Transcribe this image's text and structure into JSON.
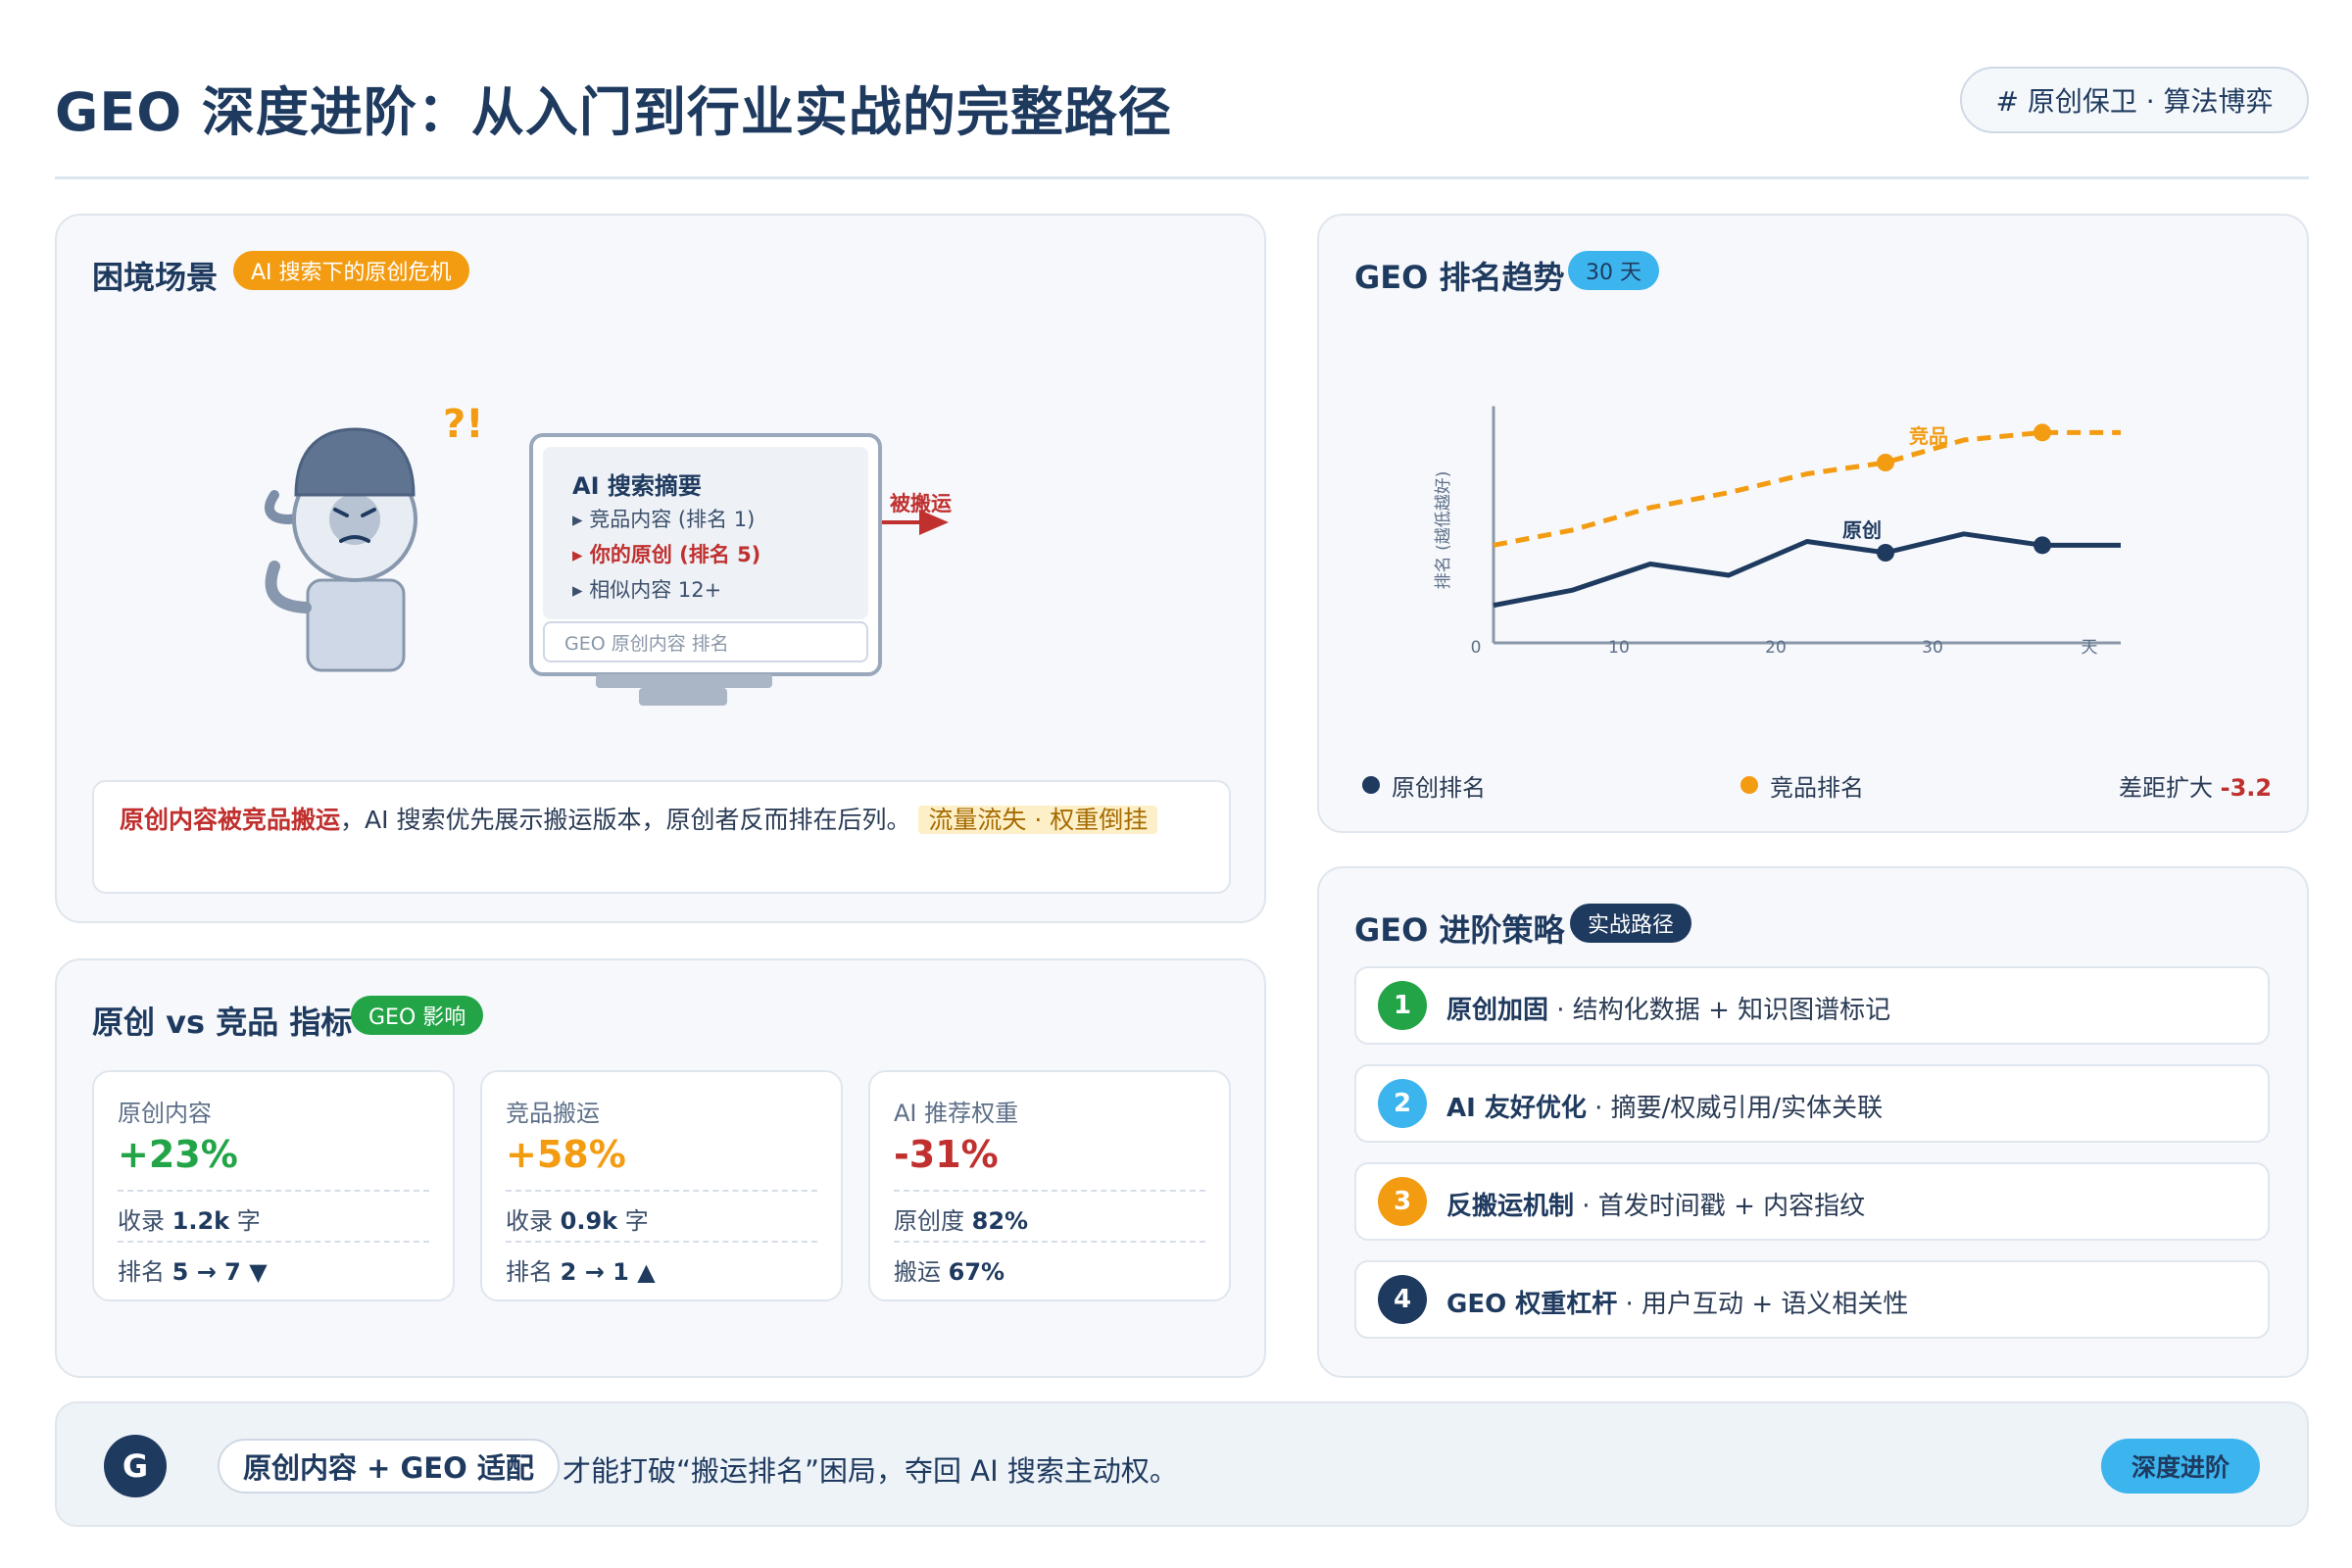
{
  "header": {
    "title": "GEO 深度进阶：从入门到行业实战的完整路径",
    "tag": "# 原创保卫 · 算法博弈"
  },
  "scenario": {
    "title": "困境场景",
    "badge": "AI 搜索下的原创危机",
    "confused_mark": "?!",
    "monitor": {
      "title": "AI 搜索摘要",
      "lines": [
        "▸ 竞品内容 (排名 1)",
        "▸ 你的原创 (排名 5)",
        "▸ 相似内容 12+"
      ],
      "search_placeholder": "GEO 原创内容 排名"
    },
    "arrow_label": "被搬运",
    "text_strong": "原创内容被竞品搬运",
    "text_body": "，AI 搜索优先展示搬运版本，原创者反而排在后列。",
    "text_highlight": "流量流失 · 权重倒挂"
  },
  "metrics": {
    "title": "原创 vs 竞品 指标",
    "badge": "GEO 影响",
    "cards": [
      {
        "label": "原创内容",
        "value": "+23%",
        "color": "#22a447",
        "row1_k": "收录 ",
        "row1_v": "1.2k",
        "row1_s": " 字",
        "row2_k": "排名 ",
        "row2_v": "5 → 7 ▼",
        "row2_s": ""
      },
      {
        "label": "竞品搬运",
        "value": "+58%",
        "color": "#f39c12",
        "row1_k": "收录 ",
        "row1_v": "0.9k",
        "row1_s": " 字",
        "row2_k": "排名 ",
        "row2_v": "2 → 1 ▲",
        "row2_s": ""
      },
      {
        "label": "AI 推荐权重",
        "value": "-31%",
        "color": "#c0302f",
        "row1_k": "原创度 ",
        "row1_v": "82%",
        "row1_s": "",
        "row2_k": "搬运 ",
        "row2_v": "67%",
        "row2_s": ""
      }
    ]
  },
  "trend": {
    "title": "GEO 排名趋势",
    "badge": "30 天",
    "legend": {
      "original": "原创排名",
      "competitor": "竞品排名",
      "gap_label": "差距扩大 ",
      "gap_value": "-3.2"
    }
  },
  "chart_data": {
    "type": "line",
    "ylabel": "排名 (越低越好)",
    "xlabel": "",
    "x_ticks": [
      "0",
      "10",
      "20",
      "30",
      "天"
    ],
    "series": [
      {
        "name": "原创",
        "color": "#1f3a5f",
        "x": [
          0,
          5,
          10,
          15,
          20,
          25,
          30,
          35,
          40
        ],
        "values": [
          1.0,
          1.4,
          2.1,
          1.8,
          2.7,
          2.4,
          2.9,
          2.6,
          2.6
        ],
        "markers": [
          5,
          7
        ]
      },
      {
        "name": "竞品",
        "color": "#f39c12",
        "x": [
          0,
          5,
          10,
          15,
          20,
          25,
          30,
          35,
          40
        ],
        "values": [
          2.6,
          3.0,
          3.6,
          4.0,
          4.5,
          4.8,
          5.4,
          5.6,
          5.6
        ],
        "markers": [
          5,
          7
        ]
      }
    ],
    "colors": {
      "original": "#1f3a5f",
      "competitor": "#f39c12",
      "axis": "#8a97a8"
    }
  },
  "strategy": {
    "title": "GEO 进阶策略",
    "badge": "实战路径",
    "steps": [
      {
        "num": "1",
        "bold": "原创加固",
        "text": " · 结构化数据 + 知识图谱标记",
        "color": "#22a447"
      },
      {
        "num": "2",
        "bold": "AI 友好优化",
        "text": " · 摘要/权威引用/实体关联",
        "color": "#3cb4ee"
      },
      {
        "num": "3",
        "bold": "反搬运机制",
        "text": " · 首发时间戳 + 内容指纹",
        "color": "#f39c12"
      },
      {
        "num": "4",
        "bold": "GEO 权重杠杆",
        "text": " · 用户互动 + 语义相关性",
        "color": "#1f3a5f"
      }
    ]
  },
  "footer": {
    "logo": "G",
    "pill": "原创内容 + GEO 适配",
    "text": "才能打破“搬运排名”困局，夺回 AI 搜索主动权。",
    "button": "深度进阶"
  }
}
